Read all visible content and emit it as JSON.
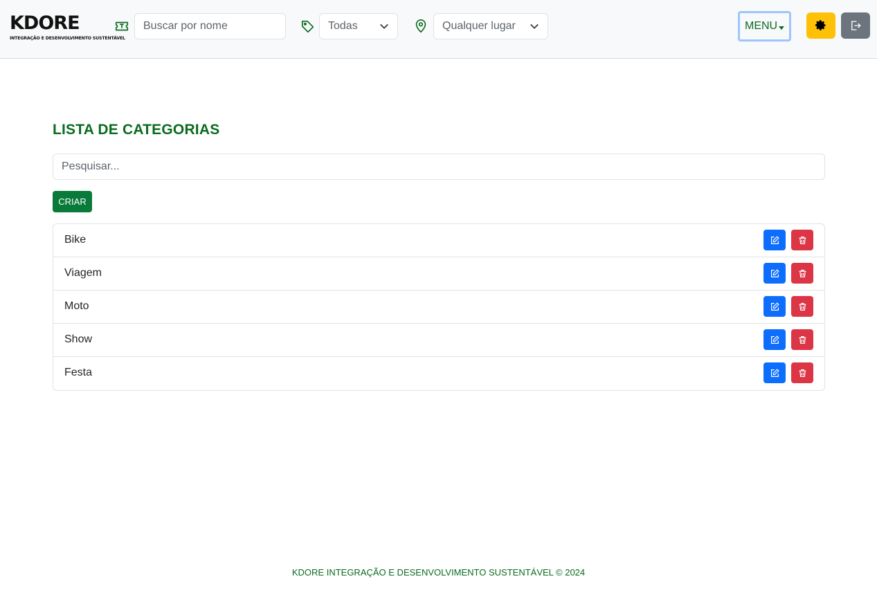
{
  "header": {
    "logo": {
      "brand": "KDORE",
      "tagline": "INTEGRAÇÃO E DESENVOLVIMENTO SUSTENTÁVEL"
    },
    "search_name": {
      "placeholder": "Buscar por nome",
      "value": ""
    },
    "category_select": {
      "selected": "Todas"
    },
    "location_select": {
      "selected": "Qualquer lugar"
    },
    "menu_label": "MENU",
    "icons": {
      "ticket": "ticket-icon",
      "tag": "tag-icon",
      "location": "map-pin-icon",
      "settings": "gear-icon",
      "logout": "logout-icon"
    },
    "colors": {
      "brand_green": "#0a6b1f",
      "settings_bg": "#ffc107",
      "logout_bg": "#6c757d"
    }
  },
  "main": {
    "title": "LISTA DE CATEGORIAS",
    "filter": {
      "placeholder": "Pesquisar...",
      "value": ""
    },
    "create_label": "CRIAR",
    "categories": [
      {
        "name": "Bike"
      },
      {
        "name": "Viagem"
      },
      {
        "name": "Moto"
      },
      {
        "name": "Show"
      },
      {
        "name": "Festa"
      }
    ],
    "row_icons": {
      "edit": "edit-icon",
      "delete": "trash-icon"
    },
    "colors": {
      "edit": "#0d6efd",
      "delete": "#dc3545",
      "create": "#0a7a3a"
    }
  },
  "footer": {
    "text": "KDORE INTEGRAÇÃO E DESENVOLVIMENTO SUSTENTÁVEL © 2024"
  }
}
